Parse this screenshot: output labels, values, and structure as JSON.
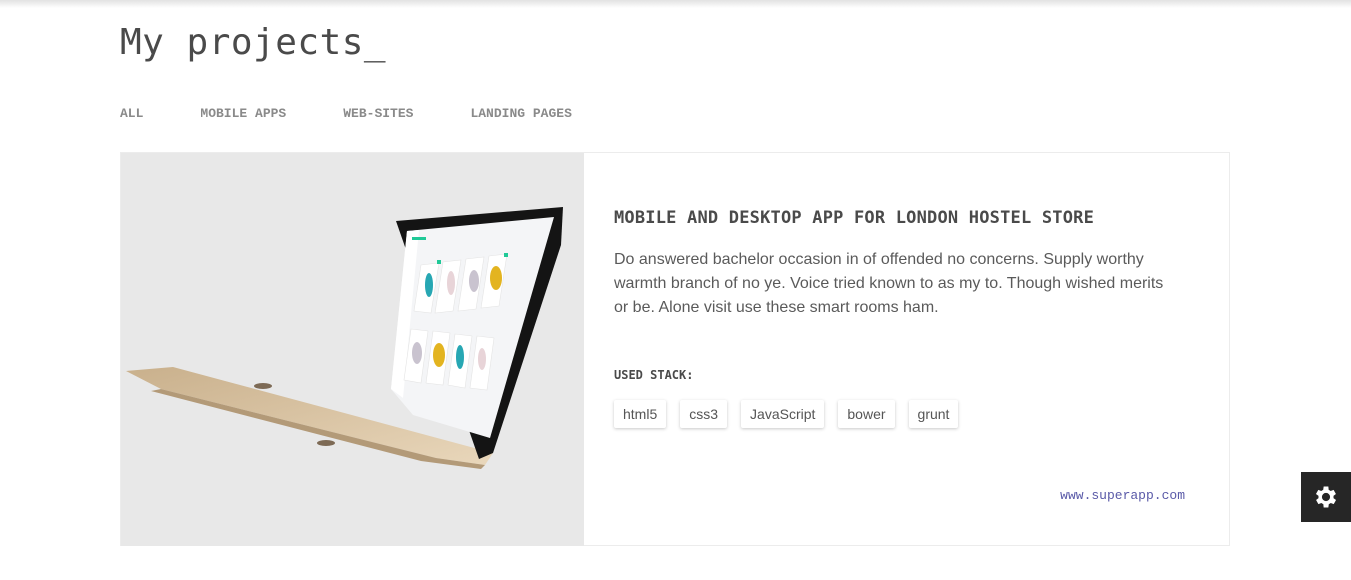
{
  "header": {
    "title": "My projects_"
  },
  "filters": [
    "ALL",
    "MOBILE APPS",
    "WEB-SITES",
    "LANDING PAGES"
  ],
  "project": {
    "title": "MOBILE AND DESKTOP APP FOR LONDON HOSTEL STORE",
    "description": "Do answered bachelor occasion in of offended no concerns. Supply worthy warmth branch of no ye. Voice tried known to as my to. Though wished merits or be. Alone visit use these smart rooms ham.",
    "stack_label": "USED STACK:",
    "stack": [
      "html5",
      "css3",
      "JavaScript",
      "bower",
      "grunt"
    ],
    "link": "www.superapp.com",
    "image": "laptop-mockup"
  },
  "settings": {
    "icon": "gear-icon"
  },
  "colors": {
    "accent_link": "#5a5aa8",
    "settings_bg": "#262626",
    "image_bg": "#e8e8e8"
  }
}
